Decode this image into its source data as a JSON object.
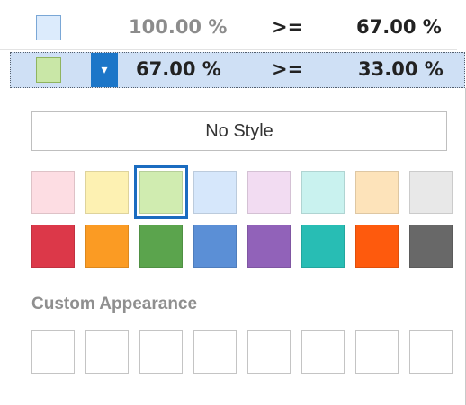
{
  "rules": [
    {
      "swatch_color": "#dcebfc",
      "value_from": "100.00 %",
      "operator": ">=",
      "value_to": "67.00 %",
      "selected": false
    },
    {
      "swatch_color": "#c9e7a7",
      "value_from": "67.00 %",
      "operator": ">=",
      "value_to": "33.00 %",
      "selected": true
    }
  ],
  "dropdown_icon": "▾",
  "popup": {
    "no_style_label": "No Style",
    "light_colors": [
      "#fddde3",
      "#fdf1b2",
      "#d0ecb0",
      "#d6e7fb",
      "#f2dcf2",
      "#c9f2ef",
      "#fde3ba",
      "#e8e8e8"
    ],
    "dark_colors": [
      "#dc3849",
      "#fb9b23",
      "#5ba44d",
      "#5b8fd6",
      "#9162b9",
      "#28bdb4",
      "#fe5a0d",
      "#686868"
    ],
    "selected_index": 2,
    "custom_label": "Custom Appearance",
    "custom_slots": [
      "",
      "",
      "",
      "",
      "",
      "",
      "",
      ""
    ]
  }
}
